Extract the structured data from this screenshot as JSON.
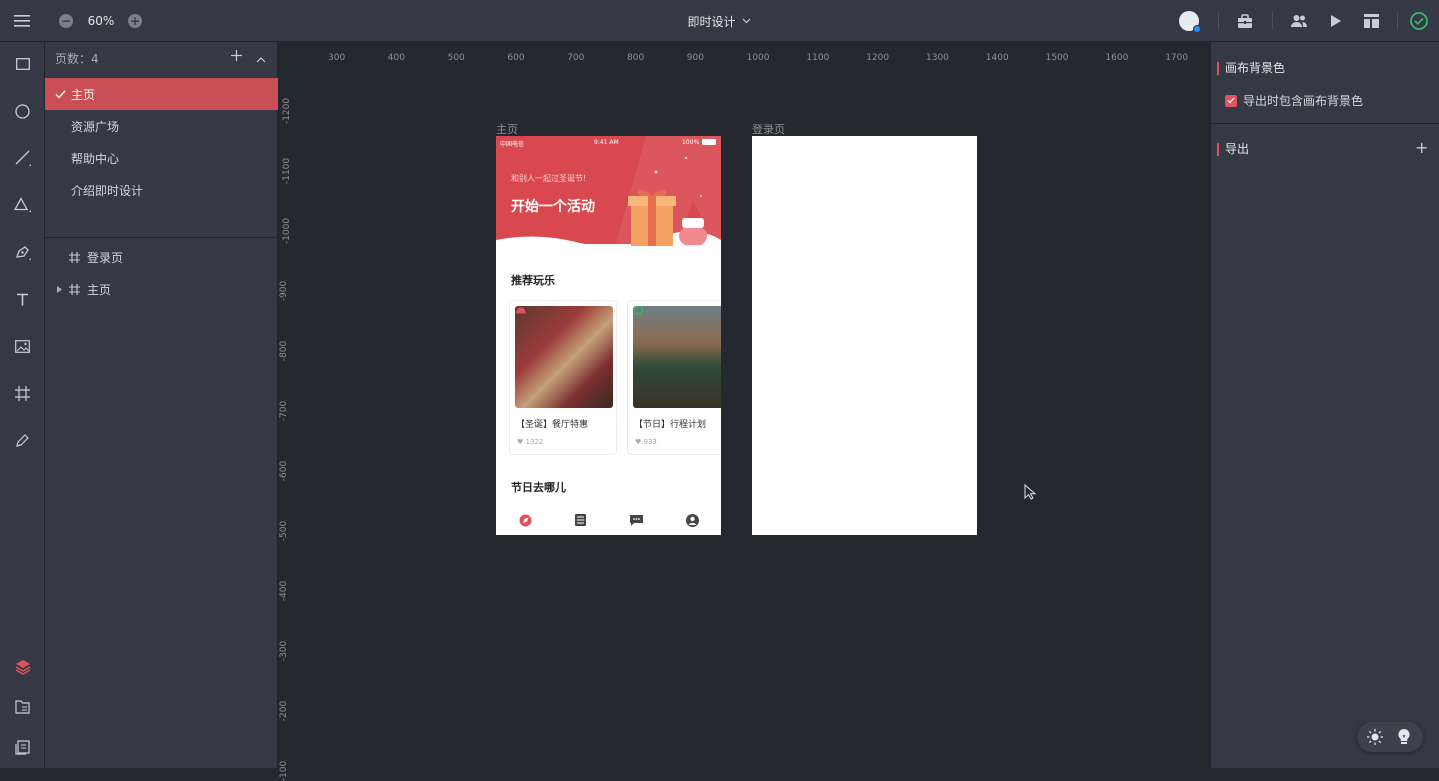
{
  "topbar": {
    "zoom": "60%",
    "zoom_out": "−",
    "zoom_in": "+",
    "project_title": "即时设计"
  },
  "left_panel": {
    "pages_count_label": "页数：4",
    "pages": [
      {
        "label": "主页",
        "selected": true
      },
      {
        "label": "资源广场"
      },
      {
        "label": "帮助中心"
      },
      {
        "label": "介绍即时设计"
      }
    ],
    "layers": [
      {
        "label": "登录页"
      },
      {
        "label": "主页"
      }
    ]
  },
  "rulers": {
    "horizontal": [
      "300",
      "400",
      "500",
      "600",
      "700",
      "800",
      "900",
      "1000",
      "1100",
      "1200",
      "1300",
      "1400",
      "1500",
      "1600",
      "1700"
    ],
    "vertical": [
      "-1200",
      "-1100",
      "-1000",
      "-900",
      "-800",
      "-700",
      "-600",
      "-500",
      "-400",
      "-300",
      "-200",
      "-100"
    ]
  },
  "canvas": {
    "artboards": [
      {
        "name": "主页"
      },
      {
        "name": "登录页"
      }
    ],
    "home": {
      "status_carrier": "中国电信",
      "status_time": "9:41 AM",
      "status_battery": "100%",
      "banner_sub": "和别人一起过圣诞节!",
      "banner_title": "开始一个活动",
      "section1": "推荐玩乐",
      "cards": [
        {
          "title": "【圣诞】餐厅特惠",
          "likes": "1322"
        },
        {
          "title": "【节日】行程计划",
          "likes": "933"
        }
      ],
      "section2": "节日去哪儿"
    }
  },
  "right_panel": {
    "canvas_bg_title": "画布背景色",
    "export_bg_label": "导出时包含画布背景色",
    "export_bg_checked": true,
    "export_title": "导出",
    "export_add": "+"
  },
  "colors": {
    "accent": "#e0525c",
    "selected_row": "#c94e55",
    "banner": "#d9484f",
    "panel": "#353945",
    "canvas": "#262830",
    "success": "#3bb46b"
  }
}
